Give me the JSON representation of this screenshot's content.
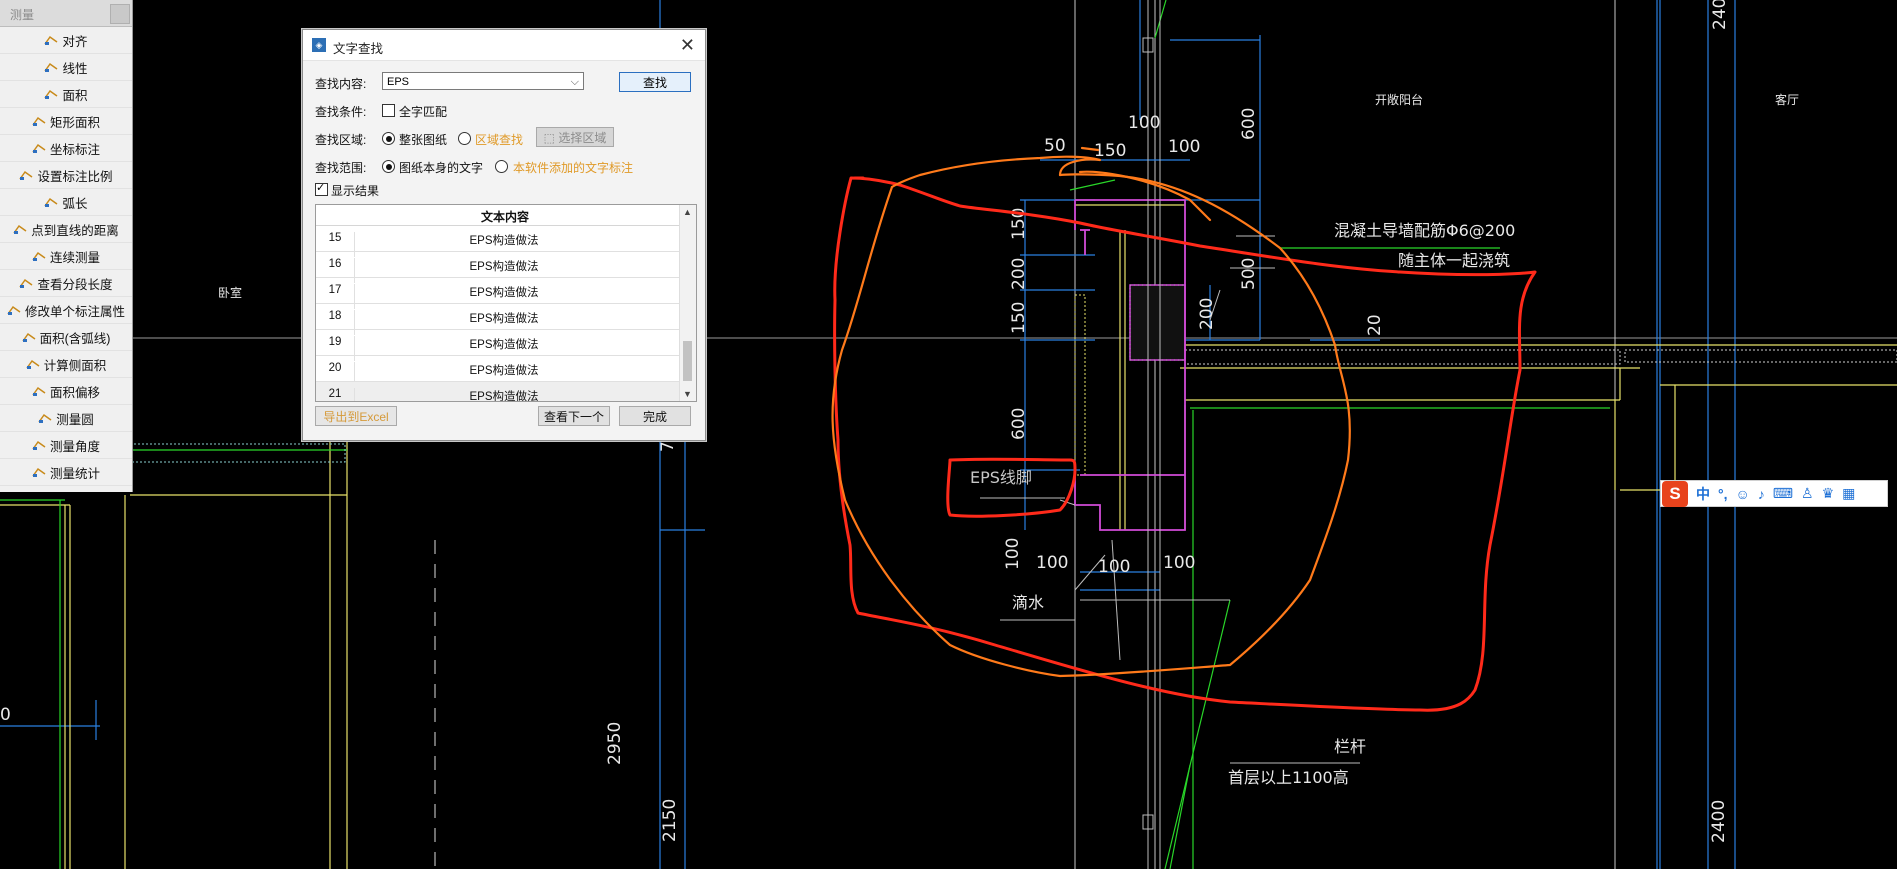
{
  "measure_panel": {
    "title": "测量",
    "tools": [
      {
        "label": "对齐",
        "icon": "align-icon"
      },
      {
        "label": "线性",
        "icon": "linear-dimension-icon"
      },
      {
        "label": "面积",
        "icon": "area-icon"
      },
      {
        "label": "矩形面积",
        "icon": "rect-area-icon"
      },
      {
        "label": "坐标标注",
        "icon": "coordinate-icon"
      },
      {
        "label": "设置标注比例",
        "icon": "scale-icon"
      },
      {
        "label": "弧长",
        "icon": "arc-length-icon"
      },
      {
        "label": "点到直线的距离",
        "icon": "point-line-icon"
      },
      {
        "label": "连续测量",
        "icon": "continuous-measure-icon"
      },
      {
        "label": "查看分段长度",
        "icon": "segment-length-icon"
      },
      {
        "label": "修改单个标注属性",
        "icon": "edit-dimension-icon"
      },
      {
        "label": "面积(含弧线)",
        "icon": "arc-area-icon"
      },
      {
        "label": "计算侧面积",
        "icon": "side-area-icon"
      },
      {
        "label": "面积偏移",
        "icon": "area-offset-icon"
      },
      {
        "label": "测量圆",
        "icon": "measure-circle-icon"
      },
      {
        "label": "测量角度",
        "icon": "measure-angle-icon"
      },
      {
        "label": "测量统计",
        "icon": "measure-stats-icon"
      }
    ]
  },
  "find_dialog": {
    "title": "文字查找",
    "content_label": "查找内容:",
    "content_value": "EPS",
    "find_button": "查找",
    "condition_label": "查找条件:",
    "whole_word": "全字匹配",
    "area_label": "查找区域:",
    "area_whole": "整张图纸",
    "area_region": "区域查找",
    "area_select": "选择区域",
    "scope_label": "查找范围:",
    "scope_drawing": "图纸本身的文字",
    "scope_added": "本软件添加的文字标注",
    "show_results": "显示结果",
    "column_header": "文本内容",
    "rows": [
      {
        "num": "15",
        "text": "EPS构造做法"
      },
      {
        "num": "16",
        "text": "EPS构造做法"
      },
      {
        "num": "17",
        "text": "EPS构造做法"
      },
      {
        "num": "18",
        "text": "EPS构造做法"
      },
      {
        "num": "19",
        "text": "EPS构造做法"
      },
      {
        "num": "20",
        "text": "EPS构造做法"
      },
      {
        "num": "21",
        "text": "EPS构造做法"
      }
    ],
    "export_button": "导出到Excel",
    "next_button": "查看下一个",
    "done_button": "完成"
  },
  "drawing": {
    "room_labels": [
      "开敞阳台",
      "客厅",
      "卧室"
    ],
    "dims": [
      "2400",
      "2400",
      "100",
      "150",
      "100",
      "50",
      "600",
      "150",
      "200",
      "150",
      "500",
      "200",
      "20",
      "600",
      "100",
      "100",
      "100",
      "100",
      "2950",
      "2150",
      "7",
      "0"
    ],
    "notes": [
      "混凝土导墙配筋Φ6@200",
      "随主体一起浇筑",
      "EPS线脚",
      "滴水",
      "栏杆",
      "首层以上1100高"
    ]
  },
  "ime_bar": {
    "logo": "S",
    "lang": "中"
  },
  "colors": {
    "dim_blue": "#2a7fe0",
    "wall_yellow": "#e8e26a",
    "markup_red": "#ff2a1a",
    "markup_orange": "#ff7a1a",
    "magenta": "#d24bd8",
    "accent_green": "#29d629"
  }
}
